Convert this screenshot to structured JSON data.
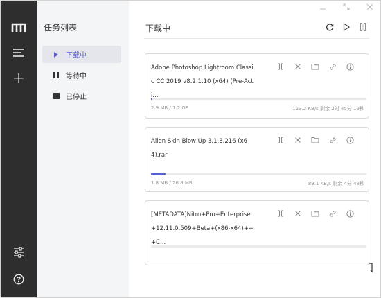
{
  "sidebar": {
    "title": "任务列表",
    "items": [
      {
        "label": "下载中",
        "icon": "play-icon",
        "active": true
      },
      {
        "label": "等待中",
        "icon": "pause-icon"
      },
      {
        "label": "已停止",
        "icon": "stop-icon"
      }
    ]
  },
  "rail": {
    "icons": [
      "app-logo-icon",
      "menu-icon",
      "add-icon",
      "settings-sliders-icon",
      "help-icon"
    ],
    "add_glyph": "+"
  },
  "main": {
    "title": "下载中",
    "actions": [
      "refresh-icon",
      "play-all-icon",
      "pause-all-icon"
    ]
  },
  "window": {
    "controls": [
      "minimize",
      "maximize",
      "close"
    ]
  },
  "colors": {
    "accent": "#5a5fd0",
    "rail_bg": "#2e2e2e",
    "sidebar_bg": "#f4f5f7"
  },
  "tasks": [
    {
      "name": "Adobe Photoshop Lightroom Classic CC 2019 v8.2.1.10 (x64) (Pre-Acti...",
      "size": "2.9 MB / 1.2 GB",
      "speed": "123.2 KB/s 剩余 2时 45分 19秒",
      "progress": 0.002
    },
    {
      "name": "Alien Skin Blow Up 3.1.3.216 (x64).rar",
      "size": "1.8 MB / 26.8 MB",
      "speed": "89.1 KB/s 剩余 4分 48秒",
      "progress": 0.067
    },
    {
      "name": "[METADATA]Nitro+Pro+Enterprise+12.11.0.509+Beta+(x86-x64)+++C...",
      "size": "",
      "speed": "",
      "progress": 0
    }
  ]
}
